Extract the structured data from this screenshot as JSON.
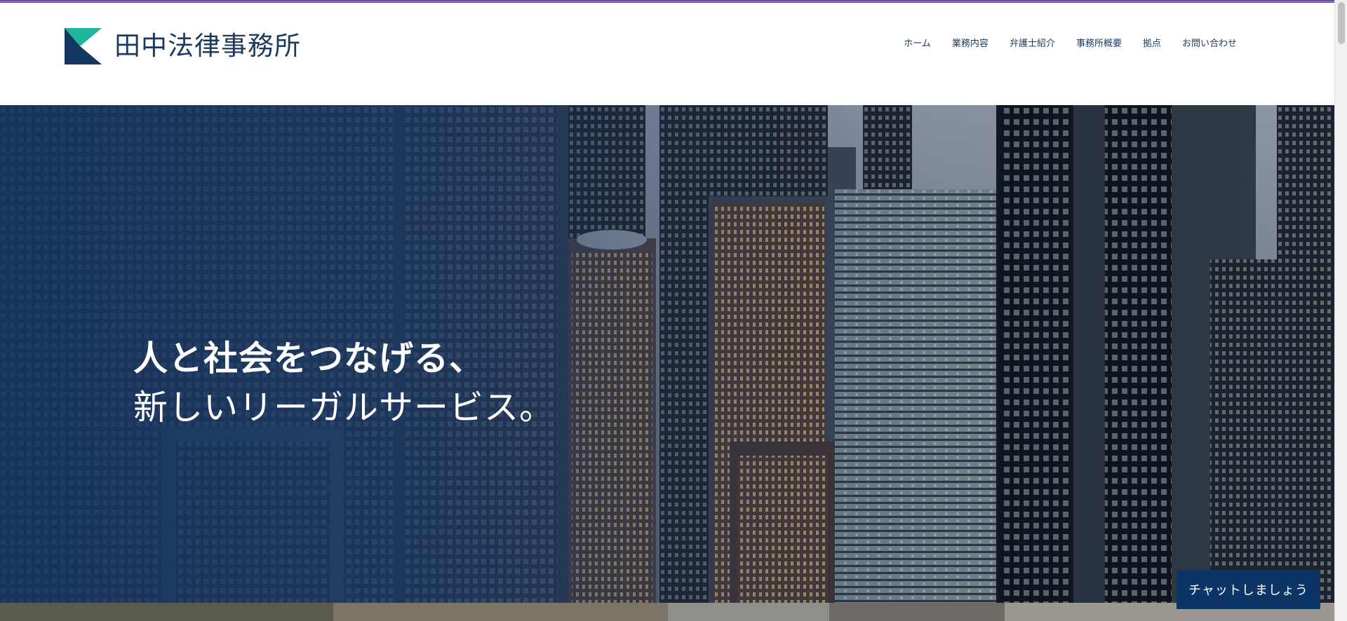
{
  "header": {
    "logo_text": "田中法律事務所",
    "nav": [
      {
        "label": "ホーム"
      },
      {
        "label": "業務内容"
      },
      {
        "label": "弁護士紹介"
      },
      {
        "label": "事務所概要"
      },
      {
        "label": "拠点"
      },
      {
        "label": "お問い合わせ"
      }
    ]
  },
  "hero": {
    "line1": "人と社会をつなげる、",
    "line2": "新しいリーガルサービス。"
  },
  "chat": {
    "label": "チャットしましょう"
  },
  "colors": {
    "brand_navy": "#1c3a5f",
    "logo_teal": "#1fb79b",
    "chat_button": "#0c3566",
    "accent_bar": "#4b2a7a"
  },
  "icons": {
    "logo_mark": "k-mark-logo-icon"
  }
}
